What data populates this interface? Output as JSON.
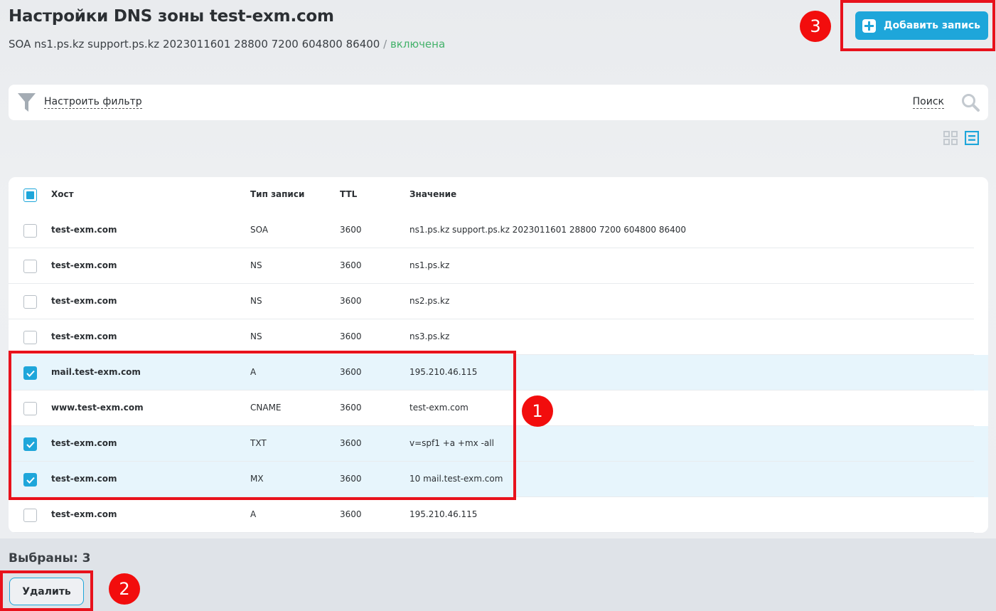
{
  "page": {
    "title": "Настройки DNS зоны test-exm.com",
    "soa_text": "SOA ns1.ps.kz support.ps.kz 2023011601 28800 7200 604800 86400",
    "separator": "/",
    "status": "включена",
    "status_color": "#43b26a"
  },
  "toolbar": {
    "add_label": "Добавить запись"
  },
  "filter": {
    "label": "Настроить фильтр",
    "search_label": "Поиск"
  },
  "table": {
    "columns": [
      "Хост",
      "Тип записи",
      "TTL",
      "Значение"
    ],
    "rows": [
      {
        "host": "test-exm.com",
        "type": "SOA",
        "ttl": "3600",
        "value": "ns1.ps.kz support.ps.kz 2023011601 28800 7200 604800 86400",
        "checked": false
      },
      {
        "host": "test-exm.com",
        "type": "NS",
        "ttl": "3600",
        "value": "ns1.ps.kz",
        "checked": false
      },
      {
        "host": "test-exm.com",
        "type": "NS",
        "ttl": "3600",
        "value": "ns2.ps.kz",
        "checked": false
      },
      {
        "host": "test-exm.com",
        "type": "NS",
        "ttl": "3600",
        "value": "ns3.ps.kz",
        "checked": false
      },
      {
        "host": "mail.test-exm.com",
        "type": "A",
        "ttl": "3600",
        "value": "195.210.46.115",
        "checked": true
      },
      {
        "host": "www.test-exm.com",
        "type": "CNAME",
        "ttl": "3600",
        "value": "test-exm.com",
        "checked": false
      },
      {
        "host": "test-exm.com",
        "type": "TXT",
        "ttl": "3600",
        "value": "v=spf1 +a +mx -all",
        "checked": true
      },
      {
        "host": "test-exm.com",
        "type": "MX",
        "ttl": "3600",
        "value": "10 mail.test-exm.com",
        "checked": true
      },
      {
        "host": "test-exm.com",
        "type": "A",
        "ttl": "3600",
        "value": "195.210.46.115",
        "checked": false
      }
    ]
  },
  "footer": {
    "selected_text": "Выбраны: 3",
    "delete_label": "Удалить"
  },
  "annotations": {
    "badge_1": "1",
    "badge_2": "2",
    "badge_3": "3"
  },
  "colors": {
    "accent": "#1ea6da",
    "annotation_red": "#e8121c",
    "selected_row": "#e7f5fc"
  },
  "icons": {
    "filter": "filter-funnel-icon",
    "search": "magnifier-icon",
    "grid_view": "grid-view-icon",
    "list_view": "list-view-icon",
    "add": "plus-square-icon",
    "check": "checkmark-icon"
  }
}
